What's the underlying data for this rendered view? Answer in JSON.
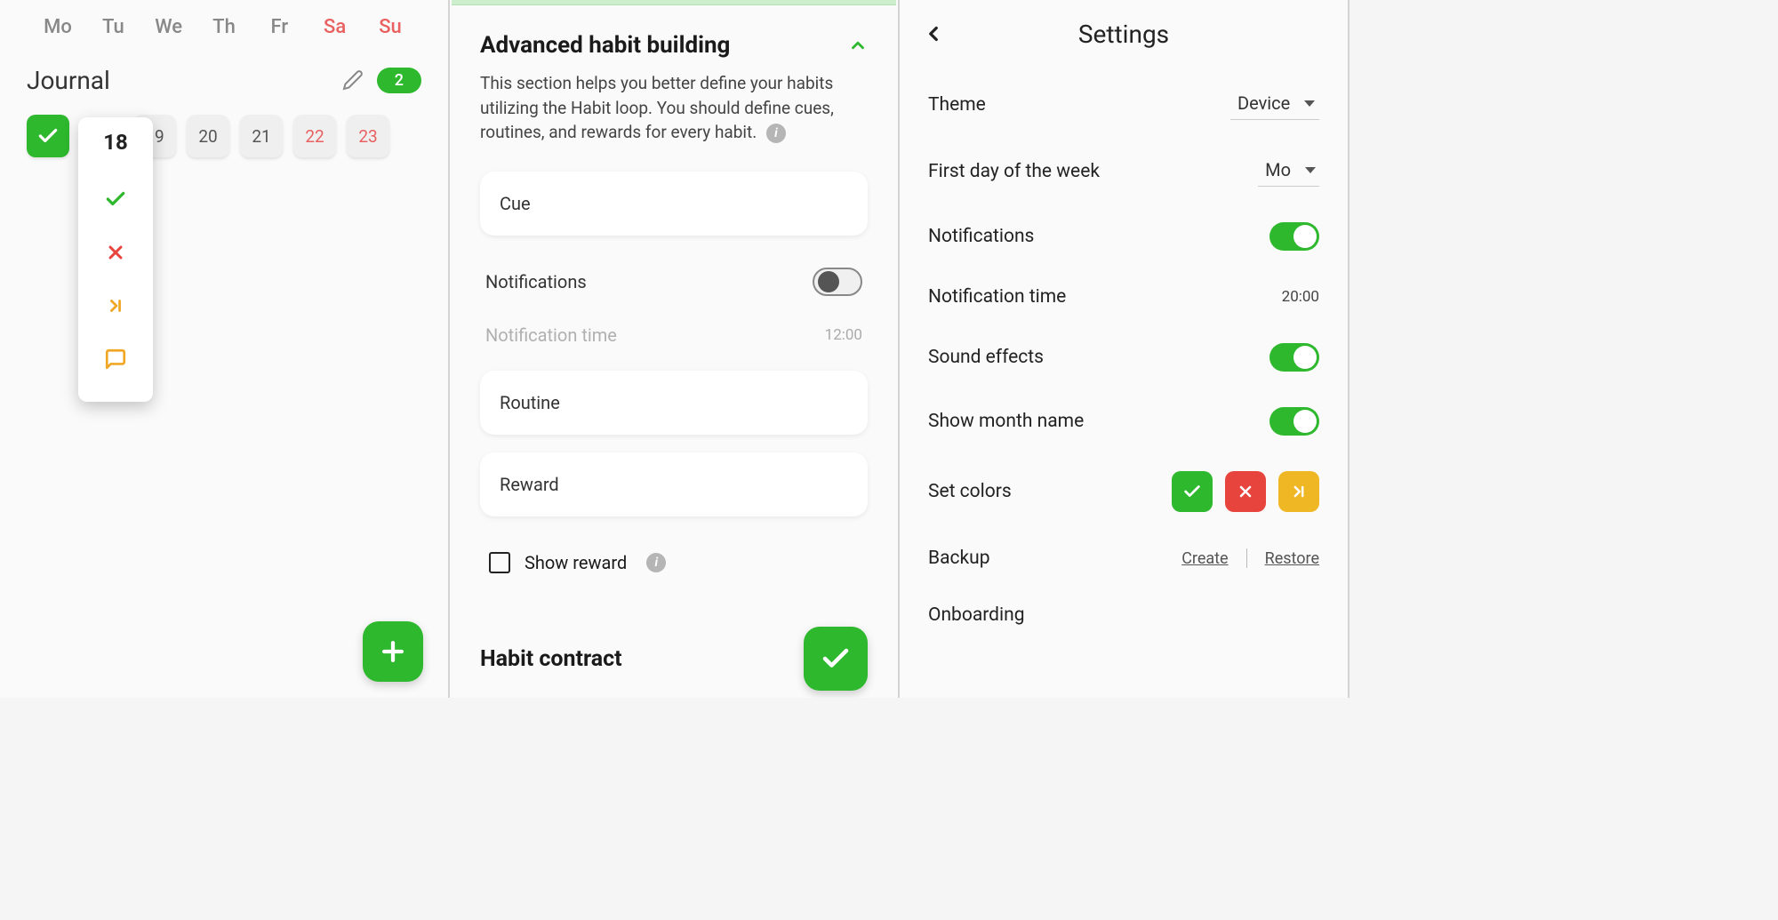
{
  "panel1": {
    "weekdays": [
      "Mo",
      "Tu",
      "We",
      "Th",
      "Fr",
      "Sa",
      "Su"
    ],
    "journal_title": "Journal",
    "badge_count": "2",
    "dates": [
      "18",
      "19",
      "20",
      "21",
      "22",
      "23"
    ],
    "popup_date": "18"
  },
  "panel2": {
    "section_title": "Advanced habit building",
    "section_desc": "This section helps you better define your habits utilizing the Habit loop. You should define cues, routines, and rewards for every habit.",
    "cue_label": "Cue",
    "notifications_label": "Notifications",
    "notification_time_label": "Notification time",
    "notification_time_value": "12:00",
    "routine_label": "Routine",
    "reward_label": "Reward",
    "show_reward_label": "Show reward",
    "habit_contract_label": "Habit contract"
  },
  "panel3": {
    "title": "Settings",
    "theme_label": "Theme",
    "theme_value": "Device",
    "first_day_label": "First day of the week",
    "first_day_value": "Mo",
    "notifications_label": "Notifications",
    "notification_time_label": "Notification time",
    "notification_time_value": "20:00",
    "sound_effects_label": "Sound effects",
    "show_month_label": "Show month name",
    "set_colors_label": "Set colors",
    "backup_label": "Backup",
    "backup_create": "Create",
    "backup_restore": "Restore",
    "onboarding_label": "Onboarding"
  }
}
